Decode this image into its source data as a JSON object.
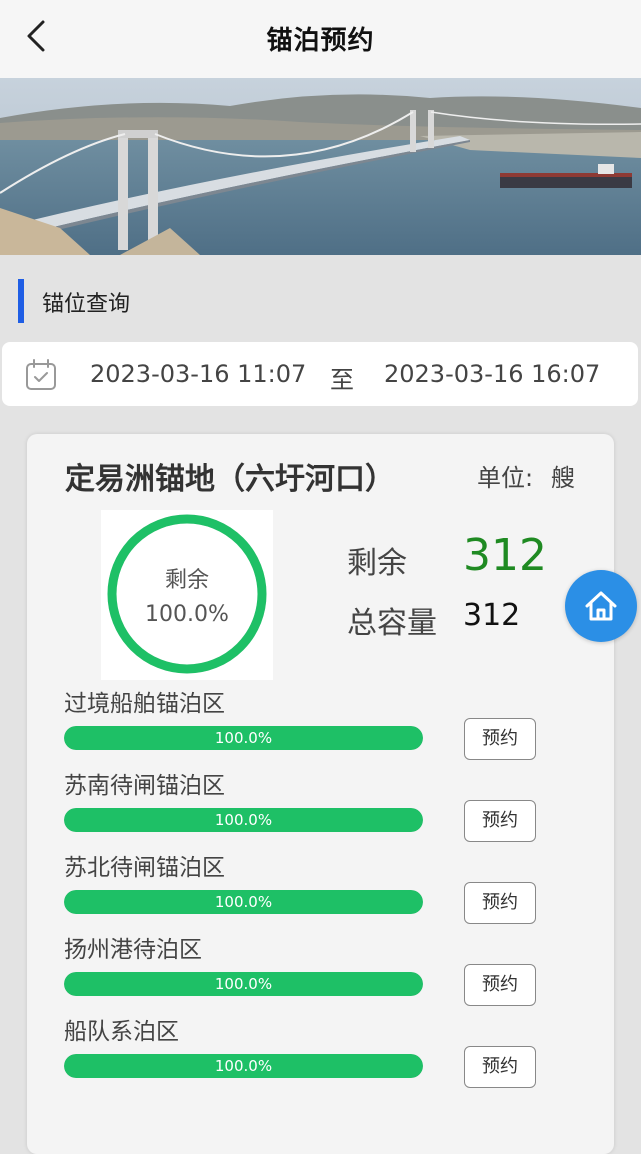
{
  "header": {
    "title": "锚泊预约"
  },
  "section": {
    "title": "锚位查询"
  },
  "date_range": {
    "start": "2023-03-16 11:07",
    "separator": "至",
    "end": "2023-03-16 16:07"
  },
  "anchorage": {
    "name": "定易洲锚地（六圩河口）",
    "unit_label": "单位:",
    "unit_value": "艘",
    "gauge": {
      "label": "剩余",
      "percent_text": "100.0%",
      "fraction": 1.0
    },
    "remaining_label": "剩余",
    "remaining_value": "312",
    "total_label": "总容量",
    "total_value": "312",
    "zones": [
      {
        "name": "过境船舶锚泊区",
        "percent_text": "100.0%",
        "fraction": 1.0,
        "button": "预约"
      },
      {
        "name": "苏南待闸锚泊区",
        "percent_text": "100.0%",
        "fraction": 1.0,
        "button": "预约"
      },
      {
        "name": "苏北待闸锚泊区",
        "percent_text": "100.0%",
        "fraction": 1.0,
        "button": "预约"
      },
      {
        "name": "扬州港待泊区",
        "percent_text": "100.0%",
        "fraction": 1.0,
        "button": "预约"
      },
      {
        "name": "船队系泊区",
        "percent_text": "100.0%",
        "fraction": 1.0,
        "button": "预约"
      }
    ]
  },
  "icons": {
    "back": "back-arrow-icon",
    "calendar": "calendar-icon",
    "home": "home-icon"
  },
  "colors": {
    "accent_blue": "#1f5ee5",
    "progress_green": "#1ec066",
    "remaining_green": "#1f8a22",
    "home_button_blue": "#2b8fe6"
  }
}
